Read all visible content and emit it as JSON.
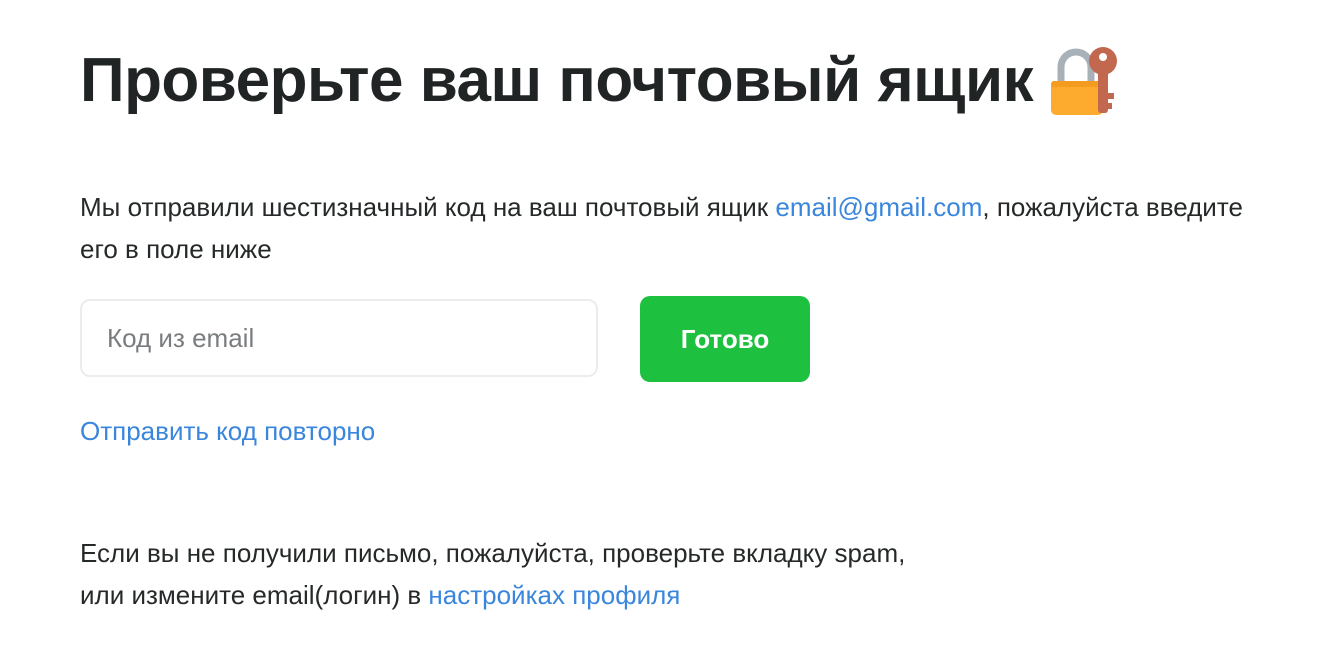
{
  "heading": {
    "title": "Проверьте ваш почтовый ящик",
    "icon": "lock-with-key-icon"
  },
  "description": {
    "before": "Мы отправили шестизначный код на ваш почтовый ящик ",
    "email": "email@gmail.com",
    "after": ", пожалуйста введите его в поле ниже"
  },
  "form": {
    "code_placeholder": "Код из email",
    "code_value": "",
    "submit_label": "Готово"
  },
  "resend_link": "Отправить код повторно",
  "note": {
    "line1": "Если вы не получили письмо, пожалуйста, проверьте вкладку spam,",
    "line2_before": "или измените email(логин) в ",
    "settings_link": "настройках профиля"
  },
  "colors": {
    "accent_link": "#3a86dc",
    "button": "#1dc13f",
    "text": "#222526"
  }
}
